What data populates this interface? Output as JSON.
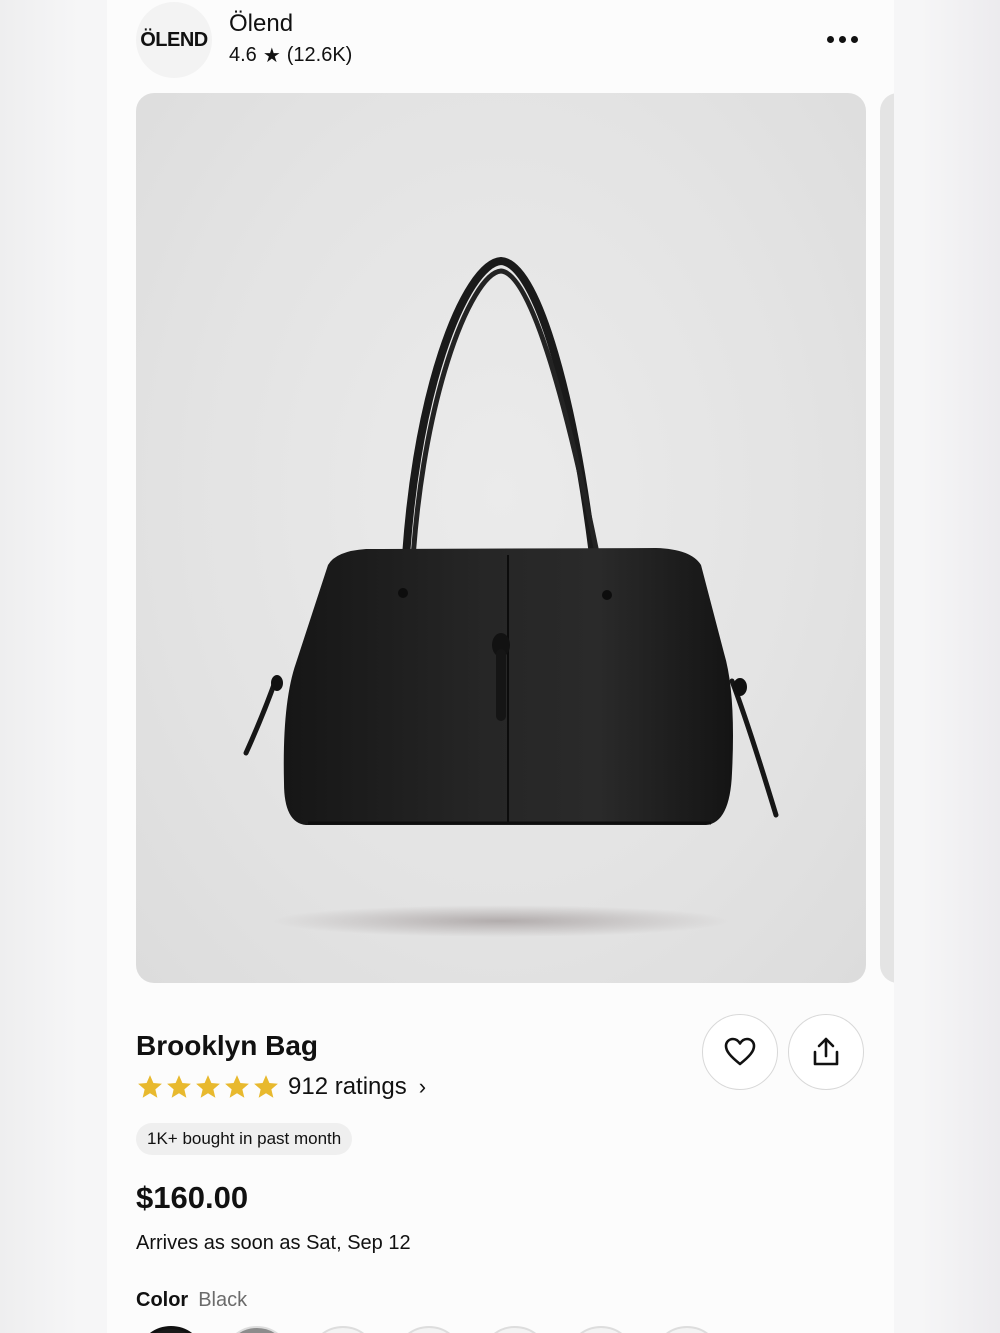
{
  "store": {
    "logo_text": "ÖLEND",
    "name": "Ölend",
    "rating": "4.6",
    "rating_count": "(12.6K)"
  },
  "product": {
    "title": "Brooklyn Bag",
    "stars": 5,
    "ratings_label": "912 ratings",
    "badge": "1K+ bought in past month",
    "price": "$160.00",
    "arrival": "Arrives as soon as Sat, Sep 12",
    "color_label": "Color",
    "color_value": "Black"
  },
  "icons": {
    "more": "more-horizontal-icon",
    "favorite": "heart-icon",
    "share": "share-icon",
    "rating": "star-icon"
  },
  "colors": {
    "star_fill": "#e8b92e",
    "bag": "#1d1d1d"
  }
}
